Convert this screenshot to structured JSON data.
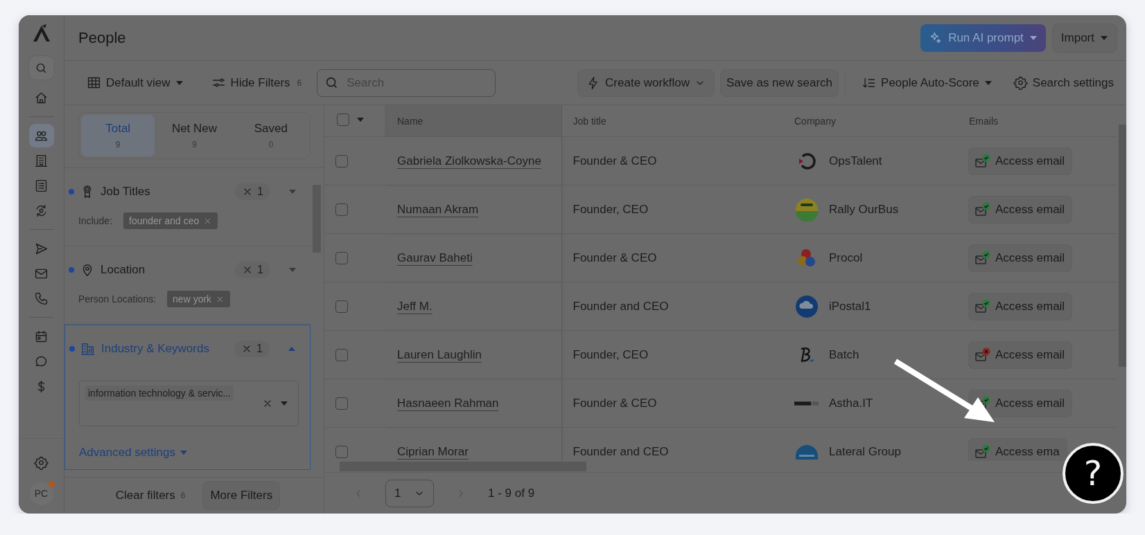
{
  "nav": [
    {
      "selected": false
    },
    {
      "selected": false
    },
    {
      "selected": true
    },
    {
      "selected": false
    },
    {
      "selected": false
    },
    {
      "selected": false
    },
    {
      "selected": false
    },
    {
      "selected": false
    },
    {
      "selected": false
    },
    {
      "selected": false
    },
    {
      "selected": false
    },
    {
      "selected": false
    },
    {
      "selected": false
    }
  ],
  "avatar": {
    "initials": "PC",
    "notification": true
  },
  "header": {
    "title": "People",
    "ai_button": "Run AI prompt",
    "import_button": "Import"
  },
  "toolbar": {
    "view": "Default view",
    "hide_filters": "Hide Filters",
    "filter_count": "6",
    "search": {
      "placeholder": "Search"
    },
    "create_workflow": "Create workflow",
    "save_search": "Save as new search",
    "auto_score": "People Auto-Score",
    "search_settings": "Search settings"
  },
  "tabs": [
    {
      "label": "Total",
      "count": "9",
      "selected": true
    },
    {
      "label": "Net New",
      "count": "9",
      "selected": false
    },
    {
      "label": "Saved",
      "count": "0",
      "selected": false
    }
  ],
  "filters": [
    {
      "title": "Job Titles",
      "active": true,
      "count": "1",
      "expanded": false,
      "criteria_label": "Include:",
      "chips": [
        "founder and ceo"
      ]
    },
    {
      "title": "Location",
      "active": true,
      "count": "1",
      "expanded": false,
      "criteria_label": "Person Locations:",
      "chips": [
        "new york"
      ]
    },
    {
      "title": "Industry & Keywords",
      "active": true,
      "count": "1",
      "expanded": true,
      "select_value": "information technology & servic...",
      "link": "Advanced settings"
    }
  ],
  "filter_footer": {
    "clear": "Clear filters",
    "clear_count": "6",
    "more": "More Filters"
  },
  "table": {
    "select_all": {
      "checked": false
    },
    "columns": [
      "Name",
      "Job title",
      "Company",
      "Emails"
    ],
    "rows": [
      {
        "checked": false,
        "name": "Gabriela Ziolkowska-Coyne",
        "job_title": "Founder & CEO",
        "company": {
          "name": "OpsTalent",
          "kind": "ring"
        },
        "email": "Access email",
        "verified": true
      },
      {
        "checked": false,
        "name": "Numaan Akram",
        "job_title": "Founder, CEO",
        "company": {
          "name": "Rally OurBus",
          "kind": "badge"
        },
        "email": "Access email",
        "verified": true
      },
      {
        "checked": false,
        "name": "Gaurav Baheti",
        "job_title": "Founder & CEO",
        "company": {
          "name": "Procol",
          "kind": "dots"
        },
        "email": "Access email",
        "verified": true
      },
      {
        "checked": false,
        "name": "Jeff M.",
        "job_title": "Founder and CEO",
        "company": {
          "name": "iPostal1",
          "kind": "cloud"
        },
        "email": "Access email",
        "verified": true
      },
      {
        "checked": false,
        "name": "Lauren Laughlin",
        "job_title": "Founder, CEO",
        "company": {
          "name": "Batch",
          "kind": "script"
        },
        "email": "Access email",
        "verified": false
      },
      {
        "checked": false,
        "name": "Hasnaeen Rahman",
        "job_title": "Founder & CEO",
        "company": {
          "name": "Astha.IT",
          "kind": "wordmark"
        },
        "email": "Access email",
        "verified": true
      },
      {
        "checked": false,
        "name": "Ciprian Morar",
        "job_title": "Founder and CEO",
        "company": {
          "name": "Lateral Group",
          "kind": "disc"
        },
        "email": "Access ema",
        "verified": true
      }
    ]
  },
  "pagination": {
    "page": "1",
    "range": "1 - 9 of 9"
  },
  "help": {
    "label": "?"
  }
}
